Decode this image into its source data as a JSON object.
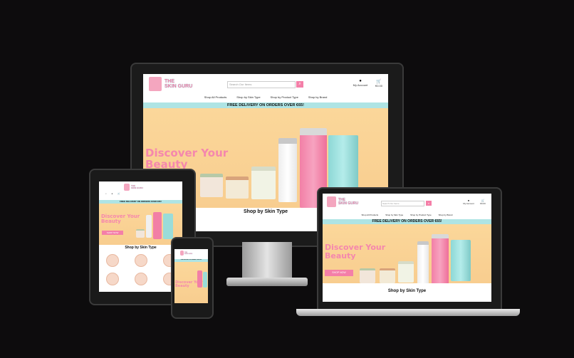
{
  "site": {
    "logo_line1": "THE",
    "logo_line2": "SKIN GURU",
    "search_placeholder": "Search Our Items",
    "search_icon": "search-icon",
    "account_label": "My Account",
    "cart_total": "€0.00",
    "nav": [
      "Shop All Products",
      "Shop by Skin Type",
      "Shop by Product Type",
      "Shop by Brand"
    ],
    "banner": "FREE DELIVERY ON ORDERS OVER €65!",
    "hero_line1": "Discover Your",
    "hero_line2": "Beauty",
    "shop_now": "SHOP NOW",
    "skin_type_title": "Shop by Skin Type"
  },
  "colors": {
    "accent_pink": "#f47fa8",
    "banner_teal": "#aee4e4",
    "hero_peach": "#fbd79a",
    "background": "#0d0c0d"
  }
}
